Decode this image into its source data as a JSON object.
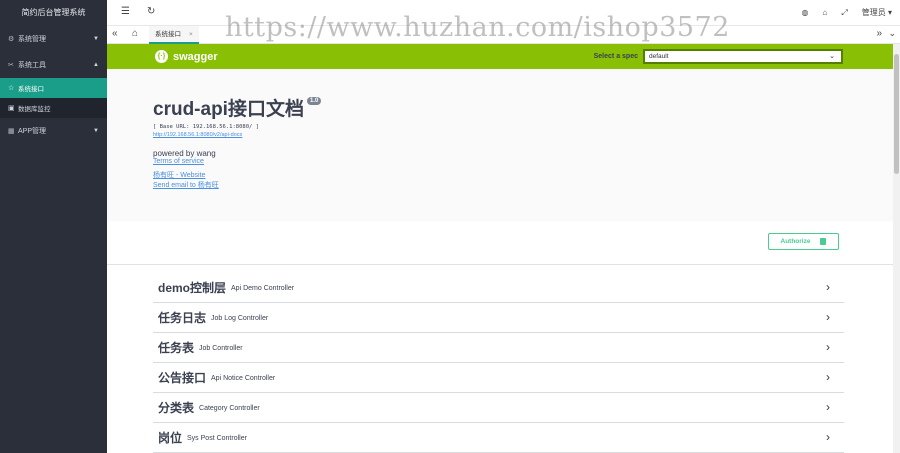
{
  "app": {
    "title": "简约后台管理系统"
  },
  "sidebar": {
    "groups": [
      {
        "label": "系统管理",
        "icon": "gear-icon",
        "expanded": false
      },
      {
        "label": "系统工具",
        "icon": "tools-icon",
        "expanded": true,
        "children": [
          {
            "label": "系统接口",
            "icon": "star-icon",
            "active": true
          },
          {
            "label": "数据库监控",
            "icon": "monitor-icon",
            "active": false
          }
        ]
      },
      {
        "label": "APP管理",
        "icon": "app-icon",
        "expanded": false
      }
    ]
  },
  "topbar": {
    "admin_label": "管理员"
  },
  "tabs": [
    {
      "label": "系统接口",
      "close": "×"
    }
  ],
  "watermark": "https://www.huzhan.com/ishop3572",
  "swagger": {
    "logo_text": "swagger",
    "spec_label": "Select a spec",
    "spec_value": "default",
    "title": "crud-api接口文档",
    "version": "1.0",
    "base_url": "[ Base URL: 192.168.56.1:8080/ ]",
    "docs_url": "http://192.168.56.1:8080/v2/api-docs",
    "description": "powered by wang",
    "terms": "Terms of service",
    "website": "杨有旺 - Website",
    "email": "Send email to 杨有旺",
    "authorize_label": "Authorize",
    "operations": [
      {
        "name": "demo控制层",
        "desc": "Api Demo Controller"
      },
      {
        "name": "任务日志",
        "desc": "Job Log Controller"
      },
      {
        "name": "任务表",
        "desc": "Job Controller"
      },
      {
        "name": "公告接口",
        "desc": "Api Notice Controller"
      },
      {
        "name": "分类表",
        "desc": "Category Controller"
      },
      {
        "name": "岗位",
        "desc": "Sys Post Controller"
      }
    ]
  },
  "colors": {
    "sidebar_bg": "#2a2f3a",
    "active_accent": "#1a9e8a",
    "swagger_green": "#89bf04",
    "authorize_green": "#49cc90"
  }
}
